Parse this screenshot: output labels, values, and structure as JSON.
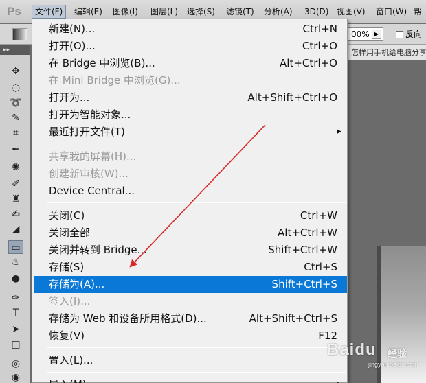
{
  "app": {
    "logo": "Ps"
  },
  "menubar": {
    "items": [
      {
        "label": "文件(F)"
      },
      {
        "label": "编辑(E)"
      },
      {
        "label": "图像(I)"
      },
      {
        "label": "图层(L)"
      },
      {
        "label": "选择(S)"
      },
      {
        "label": "滤镜(T)"
      },
      {
        "label": "分析(A)"
      },
      {
        "label": "3D(D)"
      },
      {
        "label": "视图(V)"
      },
      {
        "label": "窗口(W)"
      },
      {
        "label": "帮"
      }
    ]
  },
  "options": {
    "zoom_value": "00%",
    "reverse_label": "反向",
    "reverse_checked": false
  },
  "document": {
    "tab_title": "怎样用手机给电脑分享"
  },
  "file_menu": {
    "items": [
      {
        "label": "新建(N)...",
        "shortcut": "Ctrl+N"
      },
      {
        "label": "打开(O)...",
        "shortcut": "Ctrl+O"
      },
      {
        "label": "在 Bridge 中浏览(B)...",
        "shortcut": "Alt+Ctrl+O"
      },
      {
        "label": "在 Mini Bridge 中浏览(G)...",
        "shortcut": "",
        "disabled": true
      },
      {
        "label": "打开为...",
        "shortcut": "Alt+Shift+Ctrl+O"
      },
      {
        "label": "打开为智能对象...",
        "shortcut": ""
      },
      {
        "label": "最近打开文件(T)",
        "submenu_arrow": "▶"
      },
      {
        "label": "共享我的屏幕(H)...",
        "disabled": true
      },
      {
        "label": "创建新审核(W)...",
        "disabled": true
      },
      {
        "label": "Device Central..."
      },
      {
        "label": "关闭(C)",
        "shortcut": "Ctrl+W"
      },
      {
        "label": "关闭全部",
        "shortcut": "Alt+Ctrl+W"
      },
      {
        "label": "关闭并转到 Bridge...",
        "shortcut": "Shift+Ctrl+W"
      },
      {
        "label": "存储(S)",
        "shortcut": "Ctrl+S"
      },
      {
        "label": "存储为(A)...",
        "shortcut": "Shift+Ctrl+S",
        "highlighted": true
      },
      {
        "label": "签入(I)...",
        "disabled": true
      },
      {
        "label": "存储为 Web 和设备所用格式(D)...",
        "shortcut": "Alt+Shift+Ctrl+S"
      },
      {
        "label": "恢复(V)",
        "shortcut": "F12"
      },
      {
        "label": "置入(L)..."
      },
      {
        "label": "导入(M)",
        "submenu_arrow": "▶"
      }
    ]
  },
  "annotation": {
    "type": "arrow",
    "color": "#d62b2b"
  },
  "watermark": {
    "text": "Baidu",
    "sub": "经验",
    "url": "jingyan.baidu.com"
  },
  "colors": {
    "highlight": "#0a78d7",
    "menu_bg": "#f0f0f0",
    "disabled_text": "#9a9a9a"
  }
}
